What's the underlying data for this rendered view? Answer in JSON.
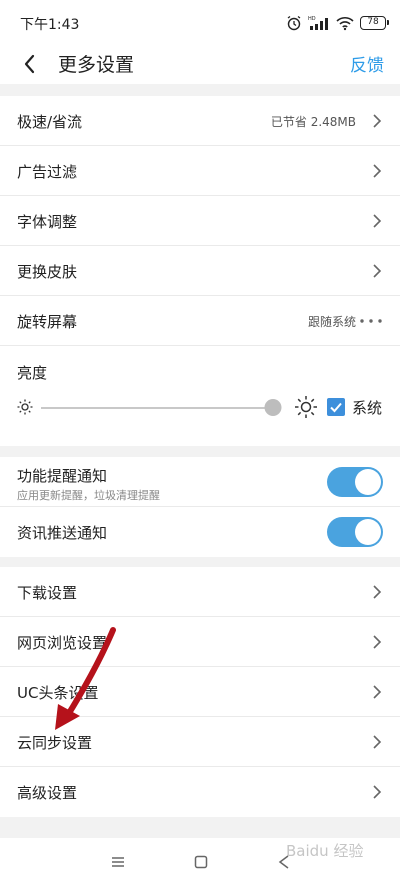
{
  "status_bar": {
    "time": "下午1:43",
    "battery": "78",
    "icons": [
      "alarm-icon",
      "hd-signal-icon",
      "wifi-icon",
      "battery-icon"
    ]
  },
  "header": {
    "title": "更多设置",
    "feedback": "反馈"
  },
  "group1": {
    "items": [
      {
        "label": "极速/省流",
        "value": "已节省 2.48MB",
        "icon": "chevron-right-icon"
      },
      {
        "label": "广告过滤",
        "icon": "chevron-right-icon"
      },
      {
        "label": "字体调整",
        "icon": "chevron-right-icon"
      },
      {
        "label": "更换皮肤",
        "icon": "chevron-right-icon"
      },
      {
        "label": "旋转屏幕",
        "value": "跟随系统",
        "icon": "more-dots-icon"
      }
    ],
    "brightness": {
      "title": "亮度",
      "level": 1.0,
      "system_checked": true,
      "system_label": "系统"
    }
  },
  "group2": {
    "items": [
      {
        "label": "功能提醒通知",
        "sub": "应用更新提醒，垃圾清理提醒",
        "on": true
      },
      {
        "label": "资讯推送通知",
        "on": true
      }
    ]
  },
  "group3": {
    "items": [
      {
        "label": "下载设置",
        "icon": "chevron-right-icon"
      },
      {
        "label": "网页浏览设置",
        "icon": "chevron-right-icon"
      },
      {
        "label": "UC头条设置",
        "icon": "chevron-right-icon"
      },
      {
        "label": "云同步设置",
        "icon": "chevron-right-icon"
      },
      {
        "label": "高级设置",
        "icon": "chevron-right-icon"
      }
    ]
  },
  "nav_bar": {
    "icons": [
      "menu-icon",
      "home-square-icon",
      "back-triangle-icon"
    ]
  },
  "watermark": "Baidu 经验",
  "colors": {
    "accent": "#2f9ce8",
    "toggle_on": "#4aa3df",
    "checkbox": "#3d8fdb",
    "annotation_arrow": "#b5121b"
  }
}
